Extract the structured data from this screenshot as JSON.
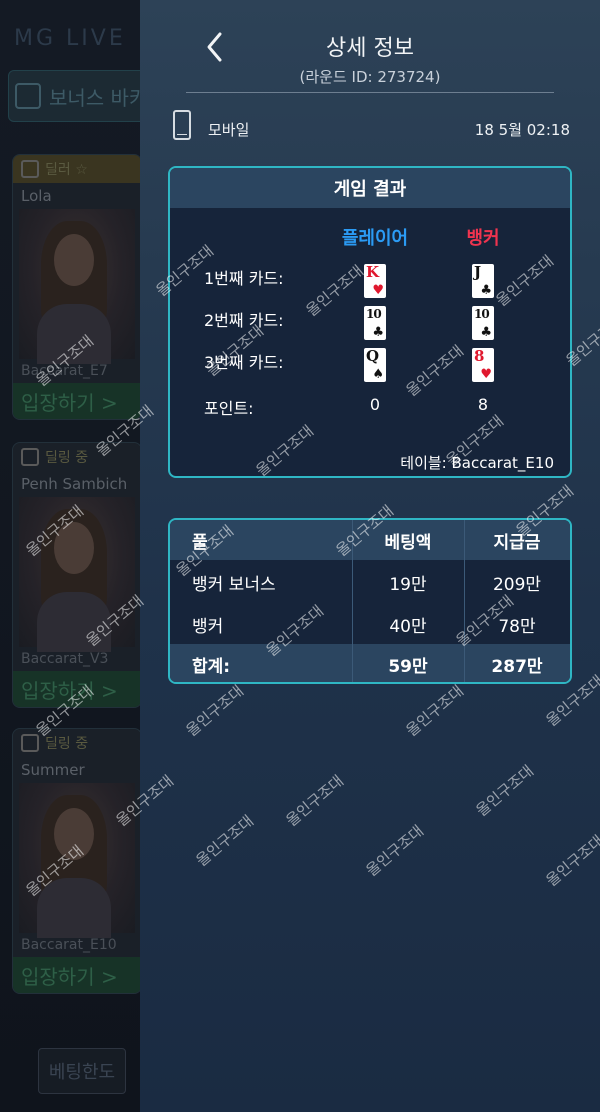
{
  "background": {
    "logo": "MG LIVE",
    "bonus_banner": "보너스 바카",
    "cards": [
      {
        "badge": "딜러 ☆",
        "dealer": "Lola",
        "table": "Baccarat_E7",
        "enter": "입장하기 >"
      },
      {
        "badge": "딜링 중",
        "dealer": "Penh Sambich",
        "table": "Baccarat_V3",
        "enter": "입장하기 >"
      },
      {
        "badge": "딜링 중",
        "dealer": "Summer",
        "table": "Baccarat_E10",
        "enter": "입장하기 >"
      }
    ],
    "bet_limit_button": "베팅한도"
  },
  "header": {
    "title": "상세 정보",
    "round_label": "(라운드 ID: ",
    "round_id": "273724",
    "round_close": ")"
  },
  "info": {
    "device_icon": "mobile-phone-icon",
    "device": "모바일",
    "datetime": "18 5월 02:18"
  },
  "result": {
    "title": "게임 결과",
    "player_label": "플레이어",
    "banker_label": "뱅커",
    "player_color": "#2b9bf4",
    "banker_color": "#f0344f",
    "rows": [
      {
        "label": "1번째 카드:",
        "player": {
          "rank": "K",
          "suit": "♥",
          "color": "red"
        },
        "banker": {
          "rank": "J",
          "suit": "♣",
          "color": "black"
        }
      },
      {
        "label": "2번째 카드:",
        "player": {
          "rank": "10",
          "suit": "♣",
          "color": "black"
        },
        "banker": {
          "rank": "10",
          "suit": "♣",
          "color": "black"
        }
      },
      {
        "label": "3번째 카드:",
        "player": {
          "rank": "Q",
          "suit": "♠",
          "color": "black"
        },
        "banker": {
          "rank": "8",
          "suit": "♥",
          "color": "red"
        }
      }
    ],
    "points_label": "포인트:",
    "player_points": "0",
    "banker_points": "8",
    "table_label": "테이블: ",
    "table_name": "Baccarat_E10"
  },
  "bets": {
    "headers": [
      "풀",
      "베팅액",
      "지급금"
    ],
    "rows": [
      {
        "pool": "뱅커 보너스",
        "bet": "19만",
        "payout": "209만"
      },
      {
        "pool": "뱅커",
        "bet": "40만",
        "payout": "78만"
      }
    ],
    "total": {
      "label": "합계:",
      "bet": "59만",
      "payout": "287만"
    }
  },
  "watermark": "올인구조대",
  "accent_color": "#2fb6c4"
}
